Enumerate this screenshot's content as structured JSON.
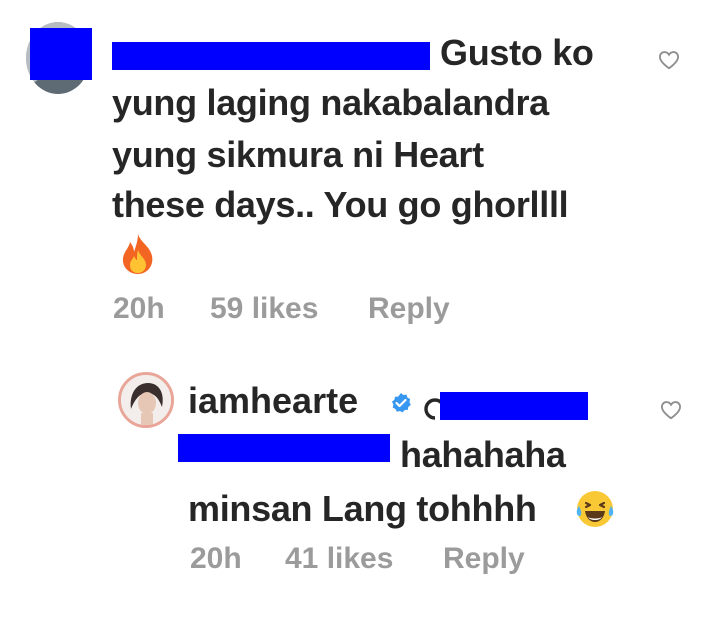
{
  "comment": {
    "text_line1": "Gusto ko",
    "text_line2": "yung laging nakabalandra",
    "text_line3": "yung sikmura ni Heart",
    "text_line4": "these days.. You go ghorllll",
    "emoji": "fire-icon",
    "time": "20h",
    "likes": "59 likes",
    "reply_label": "Reply"
  },
  "reply": {
    "username": "iamhearte",
    "text_line1": "hahahaha",
    "text_line2": "minsan Lang tohhhh",
    "emoji": "laughing-tears-icon",
    "time": "20h",
    "likes": "41 likes",
    "reply_label": "Reply"
  },
  "colors": {
    "redaction": "#0000ff",
    "meta_gray": "#9b9b9b",
    "verified_blue": "#3897f0",
    "text": "#262626"
  }
}
